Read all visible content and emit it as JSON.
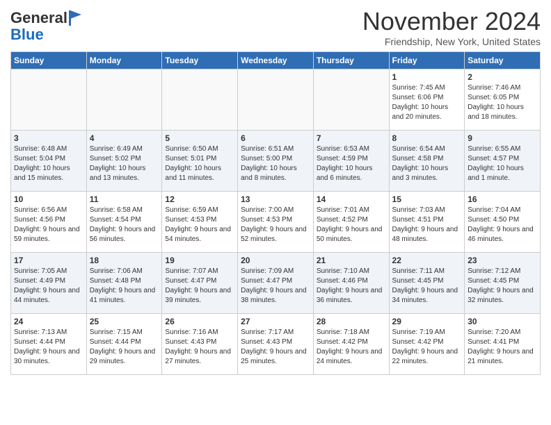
{
  "header": {
    "logo_general": "General",
    "logo_blue": "Blue",
    "month_title": "November 2024",
    "location": "Friendship, New York, United States"
  },
  "days_of_week": [
    "Sunday",
    "Monday",
    "Tuesday",
    "Wednesday",
    "Thursday",
    "Friday",
    "Saturday"
  ],
  "weeks": [
    [
      {
        "day": "",
        "info": ""
      },
      {
        "day": "",
        "info": ""
      },
      {
        "day": "",
        "info": ""
      },
      {
        "day": "",
        "info": ""
      },
      {
        "day": "",
        "info": ""
      },
      {
        "day": "1",
        "info": "Sunrise: 7:45 AM\nSunset: 6:06 PM\nDaylight: 10 hours and 20 minutes."
      },
      {
        "day": "2",
        "info": "Sunrise: 7:46 AM\nSunset: 6:05 PM\nDaylight: 10 hours and 18 minutes."
      }
    ],
    [
      {
        "day": "3",
        "info": "Sunrise: 6:48 AM\nSunset: 5:04 PM\nDaylight: 10 hours and 15 minutes."
      },
      {
        "day": "4",
        "info": "Sunrise: 6:49 AM\nSunset: 5:02 PM\nDaylight: 10 hours and 13 minutes."
      },
      {
        "day": "5",
        "info": "Sunrise: 6:50 AM\nSunset: 5:01 PM\nDaylight: 10 hours and 11 minutes."
      },
      {
        "day": "6",
        "info": "Sunrise: 6:51 AM\nSunset: 5:00 PM\nDaylight: 10 hours and 8 minutes."
      },
      {
        "day": "7",
        "info": "Sunrise: 6:53 AM\nSunset: 4:59 PM\nDaylight: 10 hours and 6 minutes."
      },
      {
        "day": "8",
        "info": "Sunrise: 6:54 AM\nSunset: 4:58 PM\nDaylight: 10 hours and 3 minutes."
      },
      {
        "day": "9",
        "info": "Sunrise: 6:55 AM\nSunset: 4:57 PM\nDaylight: 10 hours and 1 minute."
      }
    ],
    [
      {
        "day": "10",
        "info": "Sunrise: 6:56 AM\nSunset: 4:56 PM\nDaylight: 9 hours and 59 minutes."
      },
      {
        "day": "11",
        "info": "Sunrise: 6:58 AM\nSunset: 4:54 PM\nDaylight: 9 hours and 56 minutes."
      },
      {
        "day": "12",
        "info": "Sunrise: 6:59 AM\nSunset: 4:53 PM\nDaylight: 9 hours and 54 minutes."
      },
      {
        "day": "13",
        "info": "Sunrise: 7:00 AM\nSunset: 4:53 PM\nDaylight: 9 hours and 52 minutes."
      },
      {
        "day": "14",
        "info": "Sunrise: 7:01 AM\nSunset: 4:52 PM\nDaylight: 9 hours and 50 minutes."
      },
      {
        "day": "15",
        "info": "Sunrise: 7:03 AM\nSunset: 4:51 PM\nDaylight: 9 hours and 48 minutes."
      },
      {
        "day": "16",
        "info": "Sunrise: 7:04 AM\nSunset: 4:50 PM\nDaylight: 9 hours and 46 minutes."
      }
    ],
    [
      {
        "day": "17",
        "info": "Sunrise: 7:05 AM\nSunset: 4:49 PM\nDaylight: 9 hours and 44 minutes."
      },
      {
        "day": "18",
        "info": "Sunrise: 7:06 AM\nSunset: 4:48 PM\nDaylight: 9 hours and 41 minutes."
      },
      {
        "day": "19",
        "info": "Sunrise: 7:07 AM\nSunset: 4:47 PM\nDaylight: 9 hours and 39 minutes."
      },
      {
        "day": "20",
        "info": "Sunrise: 7:09 AM\nSunset: 4:47 PM\nDaylight: 9 hours and 38 minutes."
      },
      {
        "day": "21",
        "info": "Sunrise: 7:10 AM\nSunset: 4:46 PM\nDaylight: 9 hours and 36 minutes."
      },
      {
        "day": "22",
        "info": "Sunrise: 7:11 AM\nSunset: 4:45 PM\nDaylight: 9 hours and 34 minutes."
      },
      {
        "day": "23",
        "info": "Sunrise: 7:12 AM\nSunset: 4:45 PM\nDaylight: 9 hours and 32 minutes."
      }
    ],
    [
      {
        "day": "24",
        "info": "Sunrise: 7:13 AM\nSunset: 4:44 PM\nDaylight: 9 hours and 30 minutes."
      },
      {
        "day": "25",
        "info": "Sunrise: 7:15 AM\nSunset: 4:44 PM\nDaylight: 9 hours and 29 minutes."
      },
      {
        "day": "26",
        "info": "Sunrise: 7:16 AM\nSunset: 4:43 PM\nDaylight: 9 hours and 27 minutes."
      },
      {
        "day": "27",
        "info": "Sunrise: 7:17 AM\nSunset: 4:43 PM\nDaylight: 9 hours and 25 minutes."
      },
      {
        "day": "28",
        "info": "Sunrise: 7:18 AM\nSunset: 4:42 PM\nDaylight: 9 hours and 24 minutes."
      },
      {
        "day": "29",
        "info": "Sunrise: 7:19 AM\nSunset: 4:42 PM\nDaylight: 9 hours and 22 minutes."
      },
      {
        "day": "30",
        "info": "Sunrise: 7:20 AM\nSunset: 4:41 PM\nDaylight: 9 hours and 21 minutes."
      }
    ]
  ]
}
